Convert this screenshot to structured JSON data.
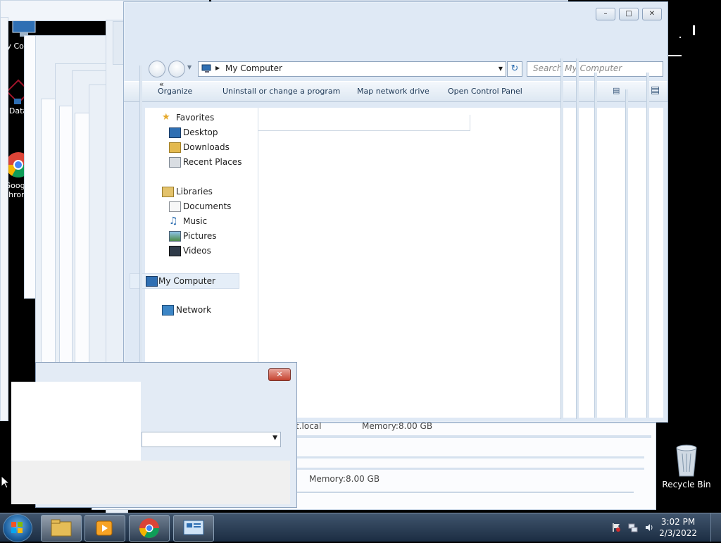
{
  "desktop": {
    "icons": [
      {
        "label": "My Computer"
      },
      {
        "label": "Data"
      },
      {
        "label": "Google Chrome"
      },
      {
        "label": "Recycle Bin"
      }
    ]
  },
  "explorer": {
    "address": "My Computer",
    "search_placeholder": "Search My Computer",
    "toolbar": {
      "organize": "Organize",
      "uninstall": "Uninstall or change a program",
      "map_drive": "Map network drive",
      "control_panel": "Open Control Panel"
    },
    "nav": {
      "favorites": "Favorites",
      "desktop": "Desktop",
      "downloads": "Downloads",
      "recent": "Recent Places",
      "libraries": "Libraries",
      "documents": "Documents",
      "music": "Music",
      "pictures": "Pictures",
      "videos": "Videos",
      "my_computer": "My Computer",
      "network": "Network"
    }
  },
  "behind": {
    "domain_text": "t.local",
    "memory_label_1": "Memory:",
    "memory_value_1": "8.00 GB",
    "memory_label_2": "Memory:",
    "memory_value_2": "8.00 GB"
  },
  "taskbar": {
    "time": "3:02 PM",
    "date": "2/3/2022"
  },
  "colors": {
    "accent": "#1c5f9e",
    "window_frame": "#dfe9f5",
    "close_red": "#c5432f"
  }
}
